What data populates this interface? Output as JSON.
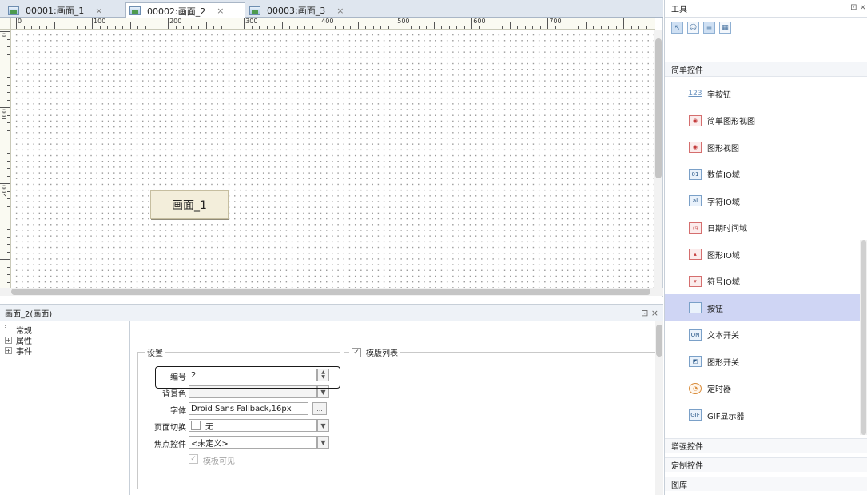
{
  "tabs": [
    {
      "label": "00001:画面_1",
      "close": "×",
      "active": false
    },
    {
      "label": "00002:画面_2",
      "close": "×",
      "active": true
    },
    {
      "label": "00003:画面_3",
      "close": "×",
      "active": false
    }
  ],
  "ruler": {
    "top_labels": [
      "0",
      "100",
      "200",
      "300",
      "400",
      "500",
      "600",
      "700"
    ],
    "left_labels": [
      "0",
      "100",
      "200"
    ]
  },
  "canvas": {
    "button_label": "画面_1"
  },
  "properties": {
    "title": "画面_2(画面)",
    "header_actions": "⊡ ×",
    "tree": [
      {
        "label": "常规",
        "expandable": false
      },
      {
        "label": "属性",
        "expandable": true
      },
      {
        "label": "事件",
        "expandable": true
      }
    ],
    "settings": {
      "group_title": "设置",
      "number_label": "编号",
      "number_value": "2",
      "bgcolor_label": "背景色",
      "bgcolor_value": "",
      "font_label": "字体",
      "font_value": "Droid Sans Fallback,16px",
      "font_button": "...",
      "page_switch_label": "页面切换",
      "page_switch_value": "无",
      "focus_label": "焦点控件",
      "focus_value": "<未定义>",
      "template_visible_label": "模板可见"
    },
    "template": {
      "title": "模版列表",
      "checked": true
    }
  },
  "toolbox": {
    "title": "工具",
    "header_actions": "⊡ ×",
    "section_simple": "简单控件",
    "items": [
      {
        "label": "字按钮",
        "icon": "text-button-icon",
        "glyph": "123"
      },
      {
        "label": "简单图形视图",
        "icon": "simple-graphic-view-icon",
        "glyph": "◉"
      },
      {
        "label": "图形视图",
        "icon": "graphic-view-icon",
        "glyph": "◉"
      },
      {
        "label": "数值IO域",
        "icon": "numeric-io-field-icon",
        "glyph": "01"
      },
      {
        "label": "字符IO域",
        "icon": "char-io-field-icon",
        "glyph": "aI"
      },
      {
        "label": "日期时间域",
        "icon": "datetime-field-icon",
        "glyph": "◷"
      },
      {
        "label": "图形IO域",
        "icon": "graphic-io-field-icon",
        "glyph": "▴"
      },
      {
        "label": "符号IO域",
        "icon": "symbol-io-field-icon",
        "glyph": "▾"
      },
      {
        "label": "按钮",
        "icon": "button-icon",
        "glyph": ""
      },
      {
        "label": "文本开关",
        "icon": "text-switch-icon",
        "glyph": "ON"
      },
      {
        "label": "图形开关",
        "icon": "graphic-switch-icon",
        "glyph": "◩"
      },
      {
        "label": "定时器",
        "icon": "timer-icon",
        "glyph": "◔"
      },
      {
        "label": "GIF显示器",
        "icon": "gif-display-icon",
        "glyph": "GIF"
      }
    ],
    "selected_index": 8,
    "sections_bottom": [
      "增强控件",
      "定制控件",
      "图库"
    ]
  }
}
